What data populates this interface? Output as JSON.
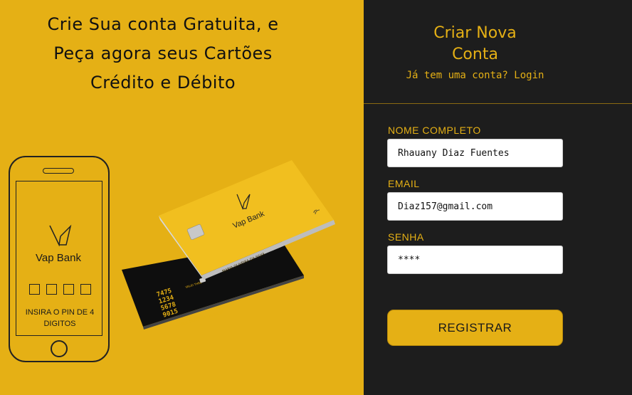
{
  "headline": {
    "line1": "Crie Sua conta Gratuita, e",
    "line2": "Peça agora seus Cartões",
    "line3": "Crédito e Débito"
  },
  "phone": {
    "brand": "Vap Bank",
    "pin_text": "INSIRA O PIN DE 4 DIGITOS"
  },
  "cards": {
    "gold_brand": "Vap Bank",
    "gold_name": "MARIA OLIVEIRA DA SILVA",
    "black_numbers": [
      "7475",
      "1234",
      "5678",
      "9015"
    ],
    "black_valid": "VALID THRU",
    "black_name": "MARIA OLIVEIRA DA SILVA"
  },
  "form": {
    "title_line1": "Criar Nova",
    "title_line2": "Conta",
    "subtitle": "Já tem uma conta? Login",
    "name_label": "NOME COMPLETO",
    "name_value": "Rhauany Diaz Fuentes",
    "email_label": "EMAIL",
    "email_value": "Diaz157@gmail.com",
    "password_label": "SENHA",
    "password_value": "****",
    "submit_label": "REGISTRAR"
  },
  "colors": {
    "accent": "#e5b015",
    "dark_panel": "#1d1d1d"
  }
}
